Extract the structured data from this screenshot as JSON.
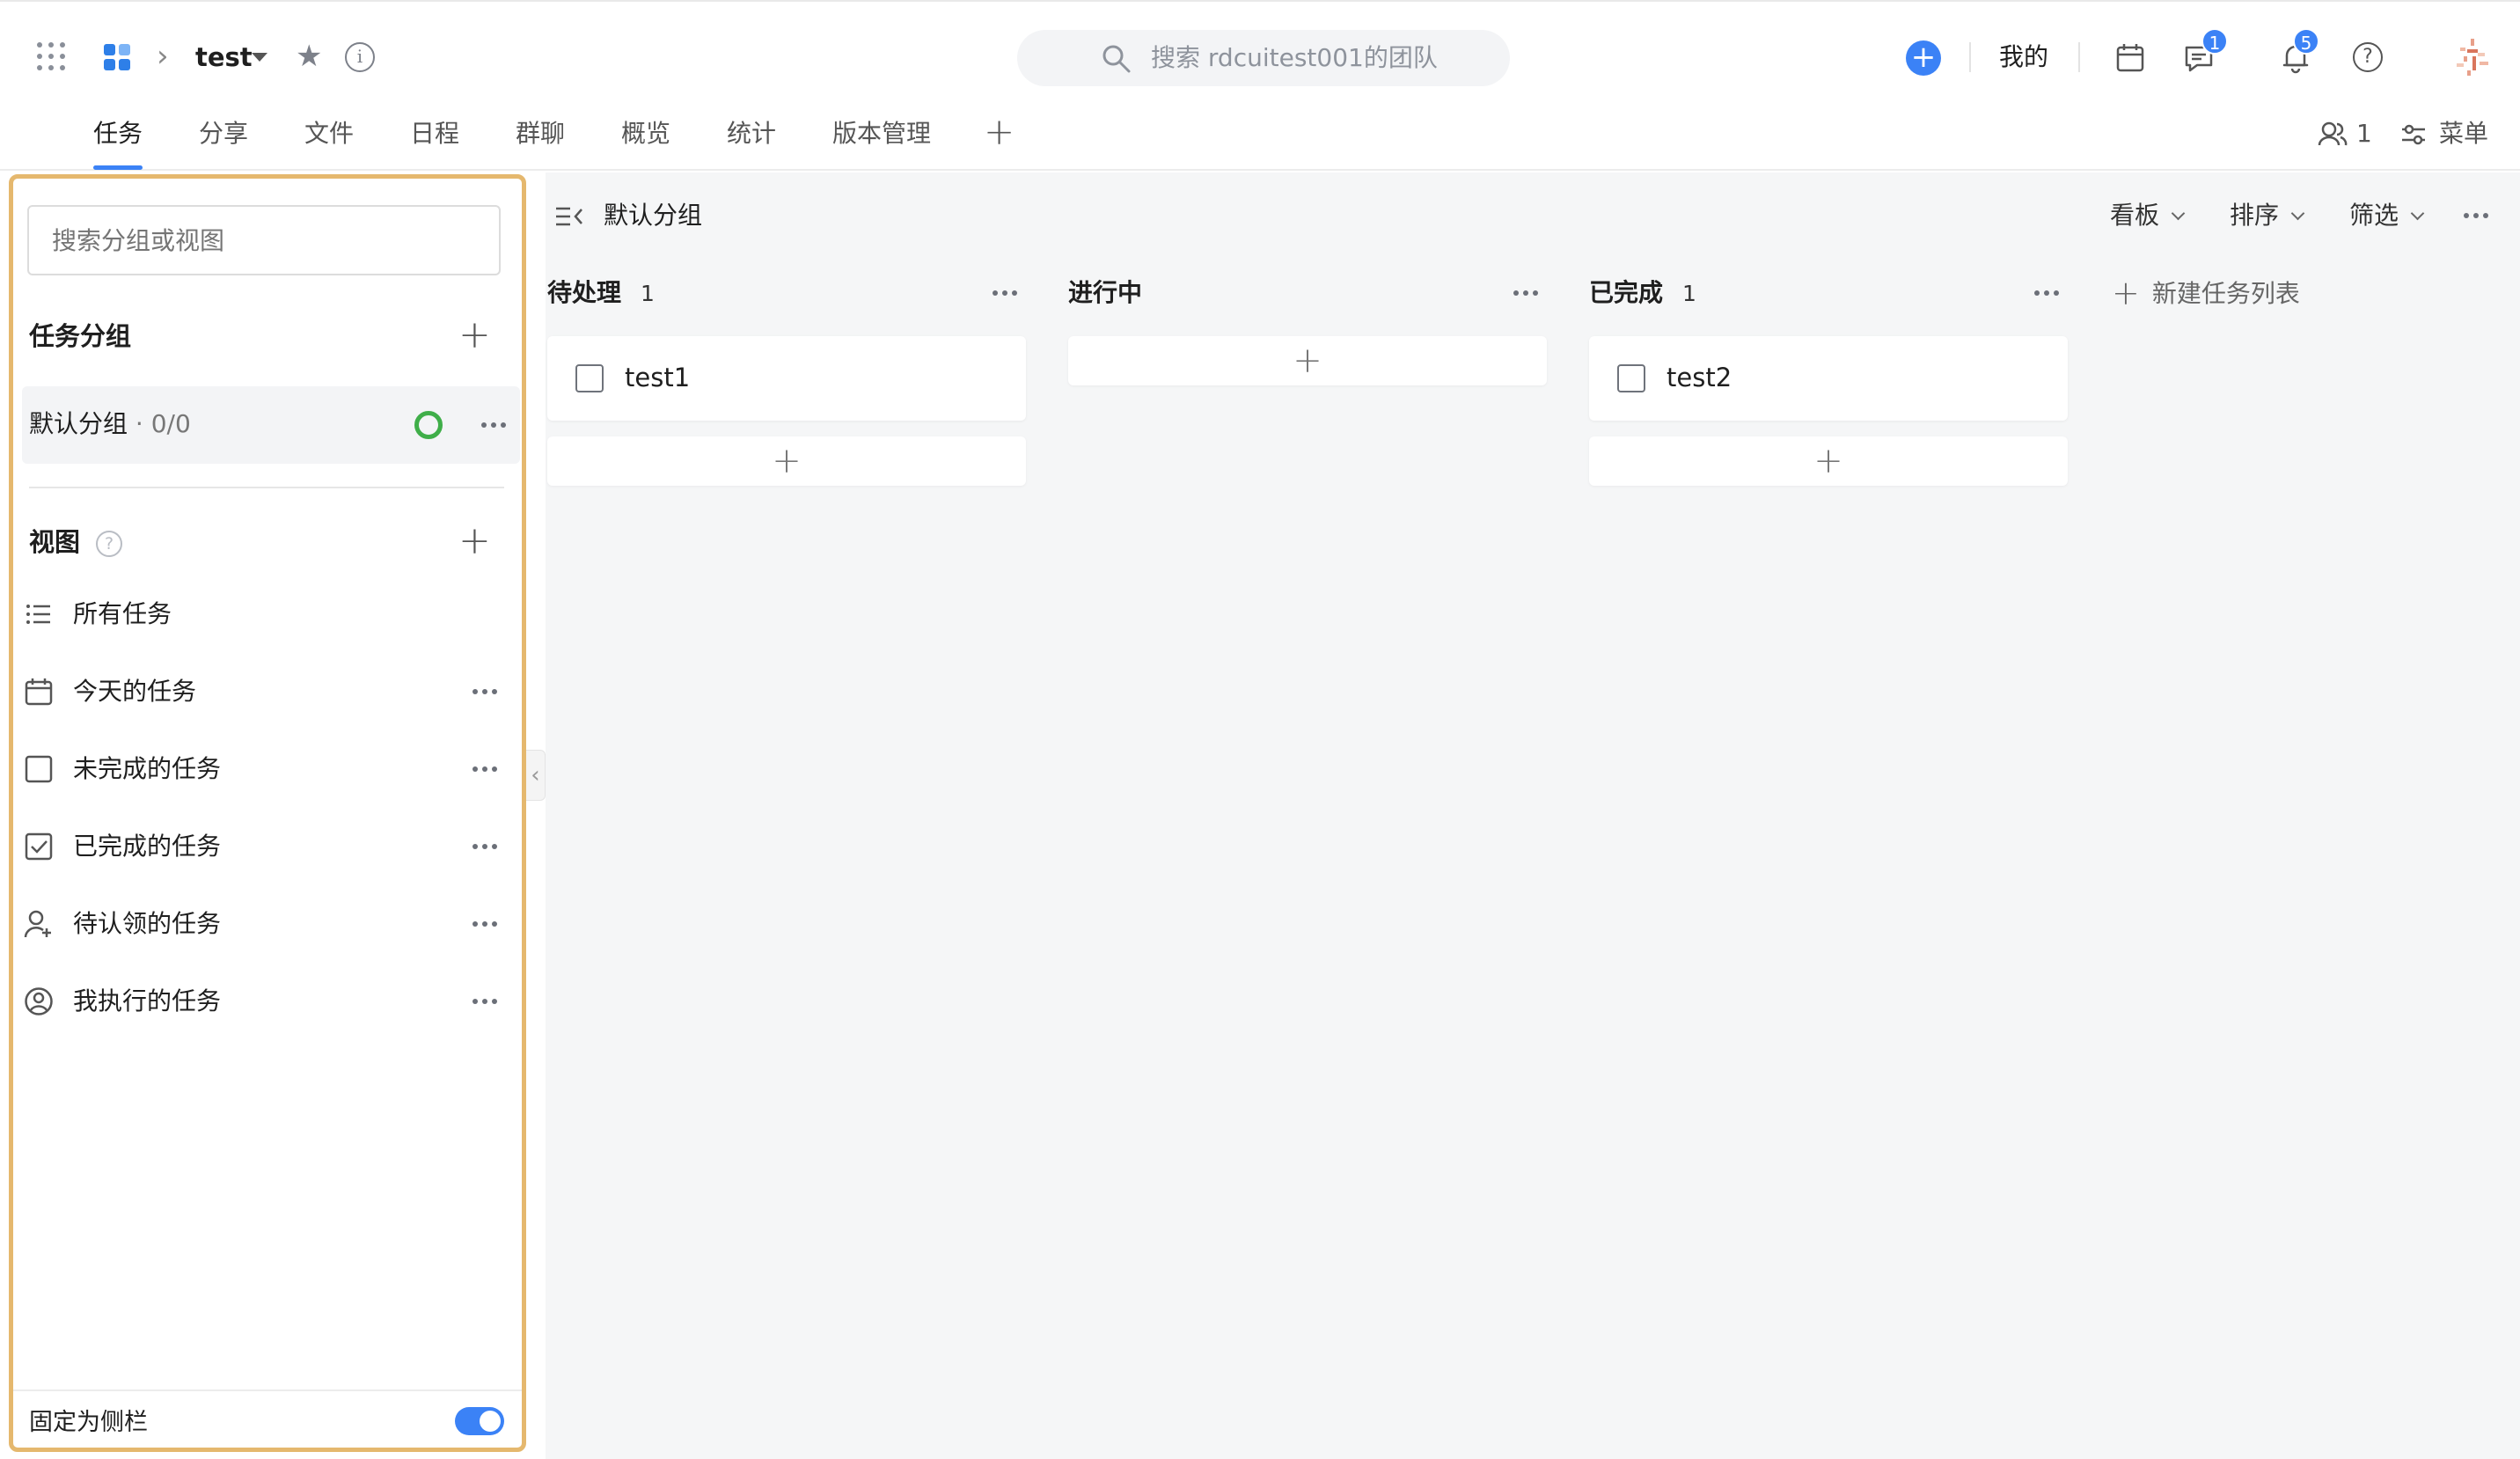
{
  "topbar": {
    "project_name": "test",
    "search_placeholder": "搜索 rdcuitest001的团队",
    "mine_label": "我的",
    "messages_badge": "1",
    "notifications_badge": "5",
    "help_glyph": "?",
    "info_glyph": "i",
    "star_glyph": "★",
    "chevron_glyph": "›",
    "add_glyph": "+",
    "accent_color": "#3b82f6"
  },
  "tabs": [
    {
      "label": "任务",
      "active": true
    },
    {
      "label": "分享",
      "active": false
    },
    {
      "label": "文件",
      "active": false
    },
    {
      "label": "日程",
      "active": false
    },
    {
      "label": "群聊",
      "active": false
    },
    {
      "label": "概览",
      "active": false
    },
    {
      "label": "统计",
      "active": false
    },
    {
      "label": "版本管理",
      "active": false
    }
  ],
  "tab_add_glyph": "+",
  "tab_right": {
    "members_count": "1",
    "menu_label": "菜单"
  },
  "sidebar": {
    "search_placeholder": "搜索分组或视图",
    "group_heading": "任务分组",
    "add_glyph": "+",
    "groups": [
      {
        "label": "默认分组",
        "count": " · 0/0"
      }
    ],
    "views_heading": "视图",
    "views_help_glyph": "?",
    "views": [
      {
        "label": "所有任务",
        "icon": "list-icon",
        "has_more": false
      },
      {
        "label": "今天的任务",
        "icon": "calendar-icon",
        "has_more": true
      },
      {
        "label": "未完成的任务",
        "icon": "checkbox-empty-icon",
        "has_more": true
      },
      {
        "label": "已完成的任务",
        "icon": "checkbox-checked-icon",
        "has_more": true
      },
      {
        "label": "待认领的任务",
        "icon": "user-add-icon",
        "has_more": true
      },
      {
        "label": "我执行的任务",
        "icon": "user-circle-icon",
        "has_more": true
      }
    ],
    "pin_label": "固定为侧栏",
    "pin_on": true,
    "collapse_glyph": "‹"
  },
  "board": {
    "breadcrumb": "默认分组",
    "toolbar": {
      "view": "看板",
      "sort": "排序",
      "filter": "筛选"
    },
    "columns": [
      {
        "title": "待处理",
        "count": "1",
        "cards": [
          "test1"
        ]
      },
      {
        "title": "进行中",
        "count": "",
        "cards": []
      },
      {
        "title": "已完成",
        "count": "1",
        "cards": [
          "test2"
        ]
      }
    ],
    "add_glyph": "+",
    "new_list_label": "新建任务列表"
  },
  "colors": {
    "accent": "#3b82f6",
    "success_ring": "#3fae49",
    "sidebar_highlight_border": "#e5b86e"
  }
}
